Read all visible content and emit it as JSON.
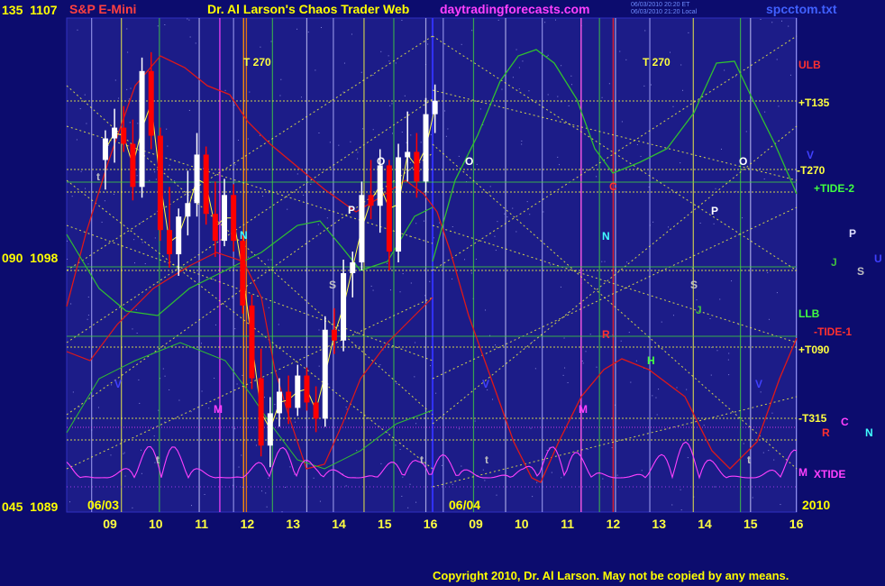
{
  "header": {
    "symbol": "S&P E-Mini",
    "title": "Dr. Al Larson's Chaos Trader Web",
    "site": "daytradingforecasts.com",
    "file": "spcctom.txt",
    "stamp_line1": "06/03/2010 20:20 ET",
    "stamp_line2": "06/03/2010 21:20 Local"
  },
  "left_axis": [
    {
      "deg": "135",
      "price": "1107"
    },
    {
      "deg": "090",
      "price": "1098"
    },
    {
      "deg": "045",
      "price": "1089"
    }
  ],
  "footer": {
    "date1": "06/03",
    "date2": "06/04",
    "year": "2010",
    "copyright": "Copyright 2010, Dr. Al Larson. May not be copied by any means."
  },
  "colors": {
    "background": "#0c0c6e",
    "plot_background": "#1c1c88",
    "plot_border": "#3030c0",
    "candle_up": "#ffffff",
    "candle_down": "#ff0000",
    "grid_yellow": "#ffff40",
    "grid_green": "#40d040",
    "red_curve": "#e01818",
    "green_curve": "#30c030",
    "magenta_curve": "#ff40ff",
    "dot_line": "#c0c040"
  },
  "chart_data": {
    "type": "candlestick",
    "title": "S&P E-Mini",
    "y_axis_labels": [
      {
        "harmonic": "135",
        "price": 1107
      },
      {
        "harmonic": "090",
        "price": 1098
      },
      {
        "harmonic": "045",
        "price": 1089
      }
    ],
    "ylim": [
      1089,
      1107
    ],
    "x_ticks": [
      "09",
      "10",
      "11",
      "12",
      "13",
      "14",
      "15",
      "16",
      "09",
      "10",
      "11",
      "12",
      "13",
      "14",
      "15",
      "16"
    ],
    "x_dates": [
      "06/03",
      "06/04"
    ],
    "price_candles_session1": [
      {
        "t": 8.9,
        "o": 1102.0,
        "h": 1103.1,
        "l": 1100.9,
        "c": 1102.8
      },
      {
        "t": 9.1,
        "o": 1102.8,
        "h": 1103.9,
        "l": 1101.9,
        "c": 1103.2
      },
      {
        "t": 9.3,
        "o": 1103.2,
        "h": 1104.0,
        "l": 1102.3,
        "c": 1102.6
      },
      {
        "t": 9.5,
        "o": 1102.6,
        "h": 1103.5,
        "l": 1100.5,
        "c": 1101.0
      },
      {
        "t": 9.7,
        "o": 1101.0,
        "h": 1105.8,
        "l": 1100.6,
        "c": 1105.3
      },
      {
        "t": 9.9,
        "o": 1105.3,
        "h": 1106.0,
        "l": 1102.4,
        "c": 1102.9
      },
      {
        "t": 10.1,
        "o": 1102.9,
        "h": 1103.2,
        "l": 1099.0,
        "c": 1099.4
      },
      {
        "t": 10.3,
        "o": 1099.4,
        "h": 1101.0,
        "l": 1098.0,
        "c": 1098.5
      },
      {
        "t": 10.5,
        "o": 1098.5,
        "h": 1100.2,
        "l": 1097.7,
        "c": 1099.9
      },
      {
        "t": 10.7,
        "o": 1099.9,
        "h": 1101.6,
        "l": 1099.2,
        "c": 1100.4
      },
      {
        "t": 10.9,
        "o": 1100.4,
        "h": 1103.0,
        "l": 1099.9,
        "c": 1102.2
      },
      {
        "t": 11.1,
        "o": 1102.2,
        "h": 1102.5,
        "l": 1099.6,
        "c": 1100.0
      },
      {
        "t": 11.3,
        "o": 1100.0,
        "h": 1101.2,
        "l": 1098.4,
        "c": 1099.0
      },
      {
        "t": 11.5,
        "o": 1099.0,
        "h": 1101.3,
        "l": 1098.8,
        "c": 1100.7
      },
      {
        "t": 11.7,
        "o": 1100.7,
        "h": 1101.1,
        "l": 1098.6,
        "c": 1099.0
      },
      {
        "t": 11.9,
        "o": 1099.0,
        "h": 1099.2,
        "l": 1096.3,
        "c": 1096.6
      },
      {
        "t": 12.1,
        "o": 1096.6,
        "h": 1097.0,
        "l": 1093.5,
        "c": 1093.9
      },
      {
        "t": 12.3,
        "o": 1093.9,
        "h": 1095.0,
        "l": 1091.0,
        "c": 1091.4
      },
      {
        "t": 12.5,
        "o": 1091.4,
        "h": 1093.2,
        "l": 1090.6,
        "c": 1092.6
      },
      {
        "t": 12.7,
        "o": 1092.6,
        "h": 1093.9,
        "l": 1092.1,
        "c": 1093.4
      },
      {
        "t": 12.9,
        "o": 1093.4,
        "h": 1094.0,
        "l": 1092.2,
        "c": 1092.8
      },
      {
        "t": 13.1,
        "o": 1092.8,
        "h": 1094.4,
        "l": 1092.5,
        "c": 1094.0
      },
      {
        "t": 13.3,
        "o": 1094.0,
        "h": 1094.3,
        "l": 1092.7,
        "c": 1093.0
      },
      {
        "t": 13.5,
        "o": 1093.0,
        "h": 1093.6,
        "l": 1091.9,
        "c": 1092.4
      },
      {
        "t": 13.7,
        "o": 1092.4,
        "h": 1096.2,
        "l": 1092.1,
        "c": 1095.7
      },
      {
        "t": 13.9,
        "o": 1095.7,
        "h": 1096.5,
        "l": 1094.8,
        "c": 1095.3
      },
      {
        "t": 14.1,
        "o": 1095.3,
        "h": 1098.3,
        "l": 1094.9,
        "c": 1097.8
      },
      {
        "t": 14.3,
        "o": 1097.8,
        "h": 1098.6,
        "l": 1096.9,
        "c": 1098.2
      },
      {
        "t": 14.5,
        "o": 1098.2,
        "h": 1101.2,
        "l": 1097.9,
        "c": 1100.7
      },
      {
        "t": 14.7,
        "o": 1100.7,
        "h": 1102.0,
        "l": 1099.8,
        "c": 1100.3
      },
      {
        "t": 14.9,
        "o": 1100.3,
        "h": 1102.4,
        "l": 1099.3,
        "c": 1101.8
      },
      {
        "t": 15.1,
        "o": 1101.8,
        "h": 1102.0,
        "l": 1097.9,
        "c": 1098.6
      },
      {
        "t": 15.3,
        "o": 1098.6,
        "h": 1102.6,
        "l": 1098.2,
        "c": 1102.1
      },
      {
        "t": 15.5,
        "o": 1102.1,
        "h": 1103.8,
        "l": 1101.2,
        "c": 1102.3
      },
      {
        "t": 15.7,
        "o": 1102.3,
        "h": 1103.0,
        "l": 1100.6,
        "c": 1101.2
      },
      {
        "t": 15.9,
        "o": 1101.2,
        "h": 1104.3,
        "l": 1100.8,
        "c": 1103.7
      },
      {
        "t": 16.1,
        "o": 1103.7,
        "h": 1104.8,
        "l": 1103.0,
        "c": 1104.2
      }
    ],
    "vertical_line_times": [
      8.6,
      9.25,
      10.08,
      10.95,
      11.7,
      11.92,
      12.55,
      13.3,
      13.88,
      14.55,
      15.2,
      15.9,
      16.28
    ],
    "vertical_line_times_day2": [
      8.95,
      9.65,
      10.45,
      11.3,
      11.7,
      12.05,
      12.8,
      13.75,
      14.78,
      15.0,
      16.0
    ],
    "right_labels": [
      {
        "text": "ULB",
        "color": "#ff3030"
      },
      {
        "text": "+T135",
        "color": "#ffff40"
      },
      {
        "text": "V",
        "color": "#4040ff"
      },
      {
        "text": "-T270",
        "color": "#ffff40"
      },
      {
        "text": "+TIDE-2",
        "color": "#40ff40"
      },
      {
        "text": "P",
        "color": "#e0e0ff"
      },
      {
        "text": "J",
        "color": "#40c040"
      },
      {
        "text": "S",
        "color": "#c0c0c0"
      },
      {
        "text": "U",
        "color": "#4040ff"
      },
      {
        "text": "LLB",
        "color": "#40ff40"
      },
      {
        "text": "-TIDE-1",
        "color": "#ff3030"
      },
      {
        "text": "+T090",
        "color": "#ffff40"
      },
      {
        "text": "-T315",
        "color": "#ffff40"
      },
      {
        "text": "C",
        "color": "#ff40ff"
      },
      {
        "text": "R",
        "color": "#ff3030"
      },
      {
        "text": "N",
        "color": "#40ffff"
      },
      {
        "text": "M",
        "color": "#ff40ff"
      },
      {
        "text": "XTIDE",
        "color": "#ff40ff"
      }
    ],
    "in_plot_labels": [
      {
        "text": "T",
        "sub": "270",
        "color": "#ffff40"
      },
      {
        "text": "T",
        "sub": "270",
        "color": "#ffff40"
      },
      {
        "text": "O",
        "color": "#ffffff"
      },
      {
        "text": "O",
        "color": "#ffffff"
      },
      {
        "text": "O",
        "color": "#ffffff"
      },
      {
        "text": "C",
        "color": "#ff3030"
      },
      {
        "text": "N",
        "color": "#40ffff"
      },
      {
        "text": "N",
        "color": "#40ffff"
      },
      {
        "text": "P",
        "color": "#ffffff"
      },
      {
        "text": "P",
        "color": "#ffffff"
      },
      {
        "text": "S",
        "color": "#c0c0c0"
      },
      {
        "text": "S",
        "color": "#c0c0c0"
      },
      {
        "text": "J",
        "color": "#40c040"
      },
      {
        "text": "R",
        "color": "#ff3030"
      },
      {
        "text": "H",
        "color": "#40ff40"
      },
      {
        "text": "M",
        "color": "#ff40ff"
      },
      {
        "text": "M",
        "color": "#ff40ff"
      },
      {
        "text": "V",
        "color": "#4040ff"
      },
      {
        "text": "V",
        "color": "#4040ff"
      },
      {
        "text": "V",
        "color": "#4040ff"
      },
      {
        "text": "t",
        "color": "#c0c0c0"
      },
      {
        "text": "t",
        "color": "#c0c0c0"
      },
      {
        "text": "t",
        "color": "#c0c0c0"
      },
      {
        "text": "t",
        "color": "#c0c0c0"
      },
      {
        "text": "t",
        "color": "#c0c0c0"
      }
    ]
  }
}
